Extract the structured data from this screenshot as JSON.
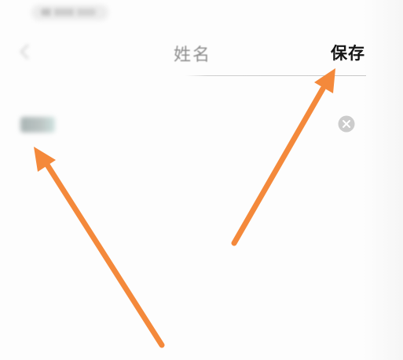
{
  "header": {
    "title": "姓名",
    "save_label": "保存"
  },
  "icons": {
    "back": "back-chevron-icon",
    "clear": "clear-circle-icon",
    "annotation": "arrow-icon"
  },
  "colors": {
    "background": "#fbfbfb",
    "title_text": "#8e8e8e",
    "save_text": "#141414",
    "divider": "#c8c8c8",
    "clear_icon": "#cccccc",
    "annotation_arrow": "#F4893B"
  }
}
